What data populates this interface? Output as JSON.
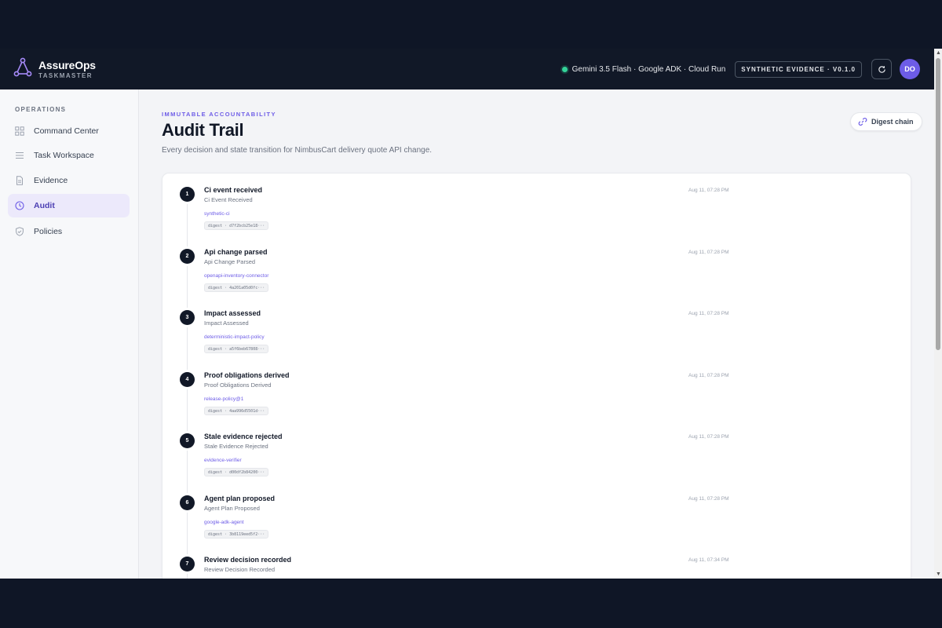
{
  "header": {
    "brand_name": "AssureOps",
    "brand_sub": "TASKMASTER",
    "status_text": "Gemini 3.5 Flash · Google ADK · Cloud Run",
    "version_badge": "SYNTHETIC EVIDENCE · V0.1.0",
    "avatar_initials": "DO"
  },
  "sidebar": {
    "section_label": "OPERATIONS",
    "items": [
      {
        "label": "Command Center",
        "icon": "grid-icon",
        "active": false
      },
      {
        "label": "Task Workspace",
        "icon": "list-icon",
        "active": false
      },
      {
        "label": "Evidence",
        "icon": "document-icon",
        "active": false
      },
      {
        "label": "Audit",
        "icon": "clock-icon",
        "active": true
      },
      {
        "label": "Policies",
        "icon": "shield-icon",
        "active": false
      }
    ]
  },
  "main": {
    "eyebrow": "IMMUTABLE ACCOUNTABILITY",
    "title": "Audit Trail",
    "subtitle": "Every decision and state transition for NimbusCart delivery quote API change.",
    "digest_button": "Digest chain"
  },
  "events": [
    {
      "step": "1",
      "title": "Ci event received",
      "subtitle": "Ci Event Received",
      "actor": "synthetic-ci",
      "digest": "digest · d7f2bcb25e18···",
      "time": "Aug 11, 07:28 PM"
    },
    {
      "step": "2",
      "title": "Api change parsed",
      "subtitle": "Api Change Parsed",
      "actor": "openapi-inventory-connector",
      "digest": "digest · 4a201a05d0fc···",
      "time": "Aug 11, 07:28 PM"
    },
    {
      "step": "3",
      "title": "Impact assessed",
      "subtitle": "Impact Assessed",
      "actor": "deterministic-impact-policy",
      "digest": "digest · a5f6beb67808···",
      "time": "Aug 11, 07:28 PM"
    },
    {
      "step": "4",
      "title": "Proof obligations derived",
      "subtitle": "Proof Obligations Derived",
      "actor": "release-policy@1",
      "digest": "digest · 4aa996d5501d···",
      "time": "Aug 11, 07:28 PM"
    },
    {
      "step": "5",
      "title": "Stale evidence rejected",
      "subtitle": "Stale Evidence Rejected",
      "actor": "evidence-verifier",
      "digest": "digest · d00df2b84200···",
      "time": "Aug 11, 07:28 PM"
    },
    {
      "step": "6",
      "title": "Agent plan proposed",
      "subtitle": "Agent Plan Proposed",
      "actor": "google-adk-agent",
      "digest": "digest · 3b8119eed5f2···",
      "time": "Aug 11, 07:28 PM"
    },
    {
      "step": "7",
      "title": "Review decision recorded",
      "subtitle": "Review Decision Recorded",
      "actor": "",
      "digest": "",
      "time": "Aug 11, 07:34 PM"
    }
  ],
  "colors": {
    "accent": "#6d5ce7",
    "header_bg": "#111827",
    "status_green": "#34d399"
  }
}
